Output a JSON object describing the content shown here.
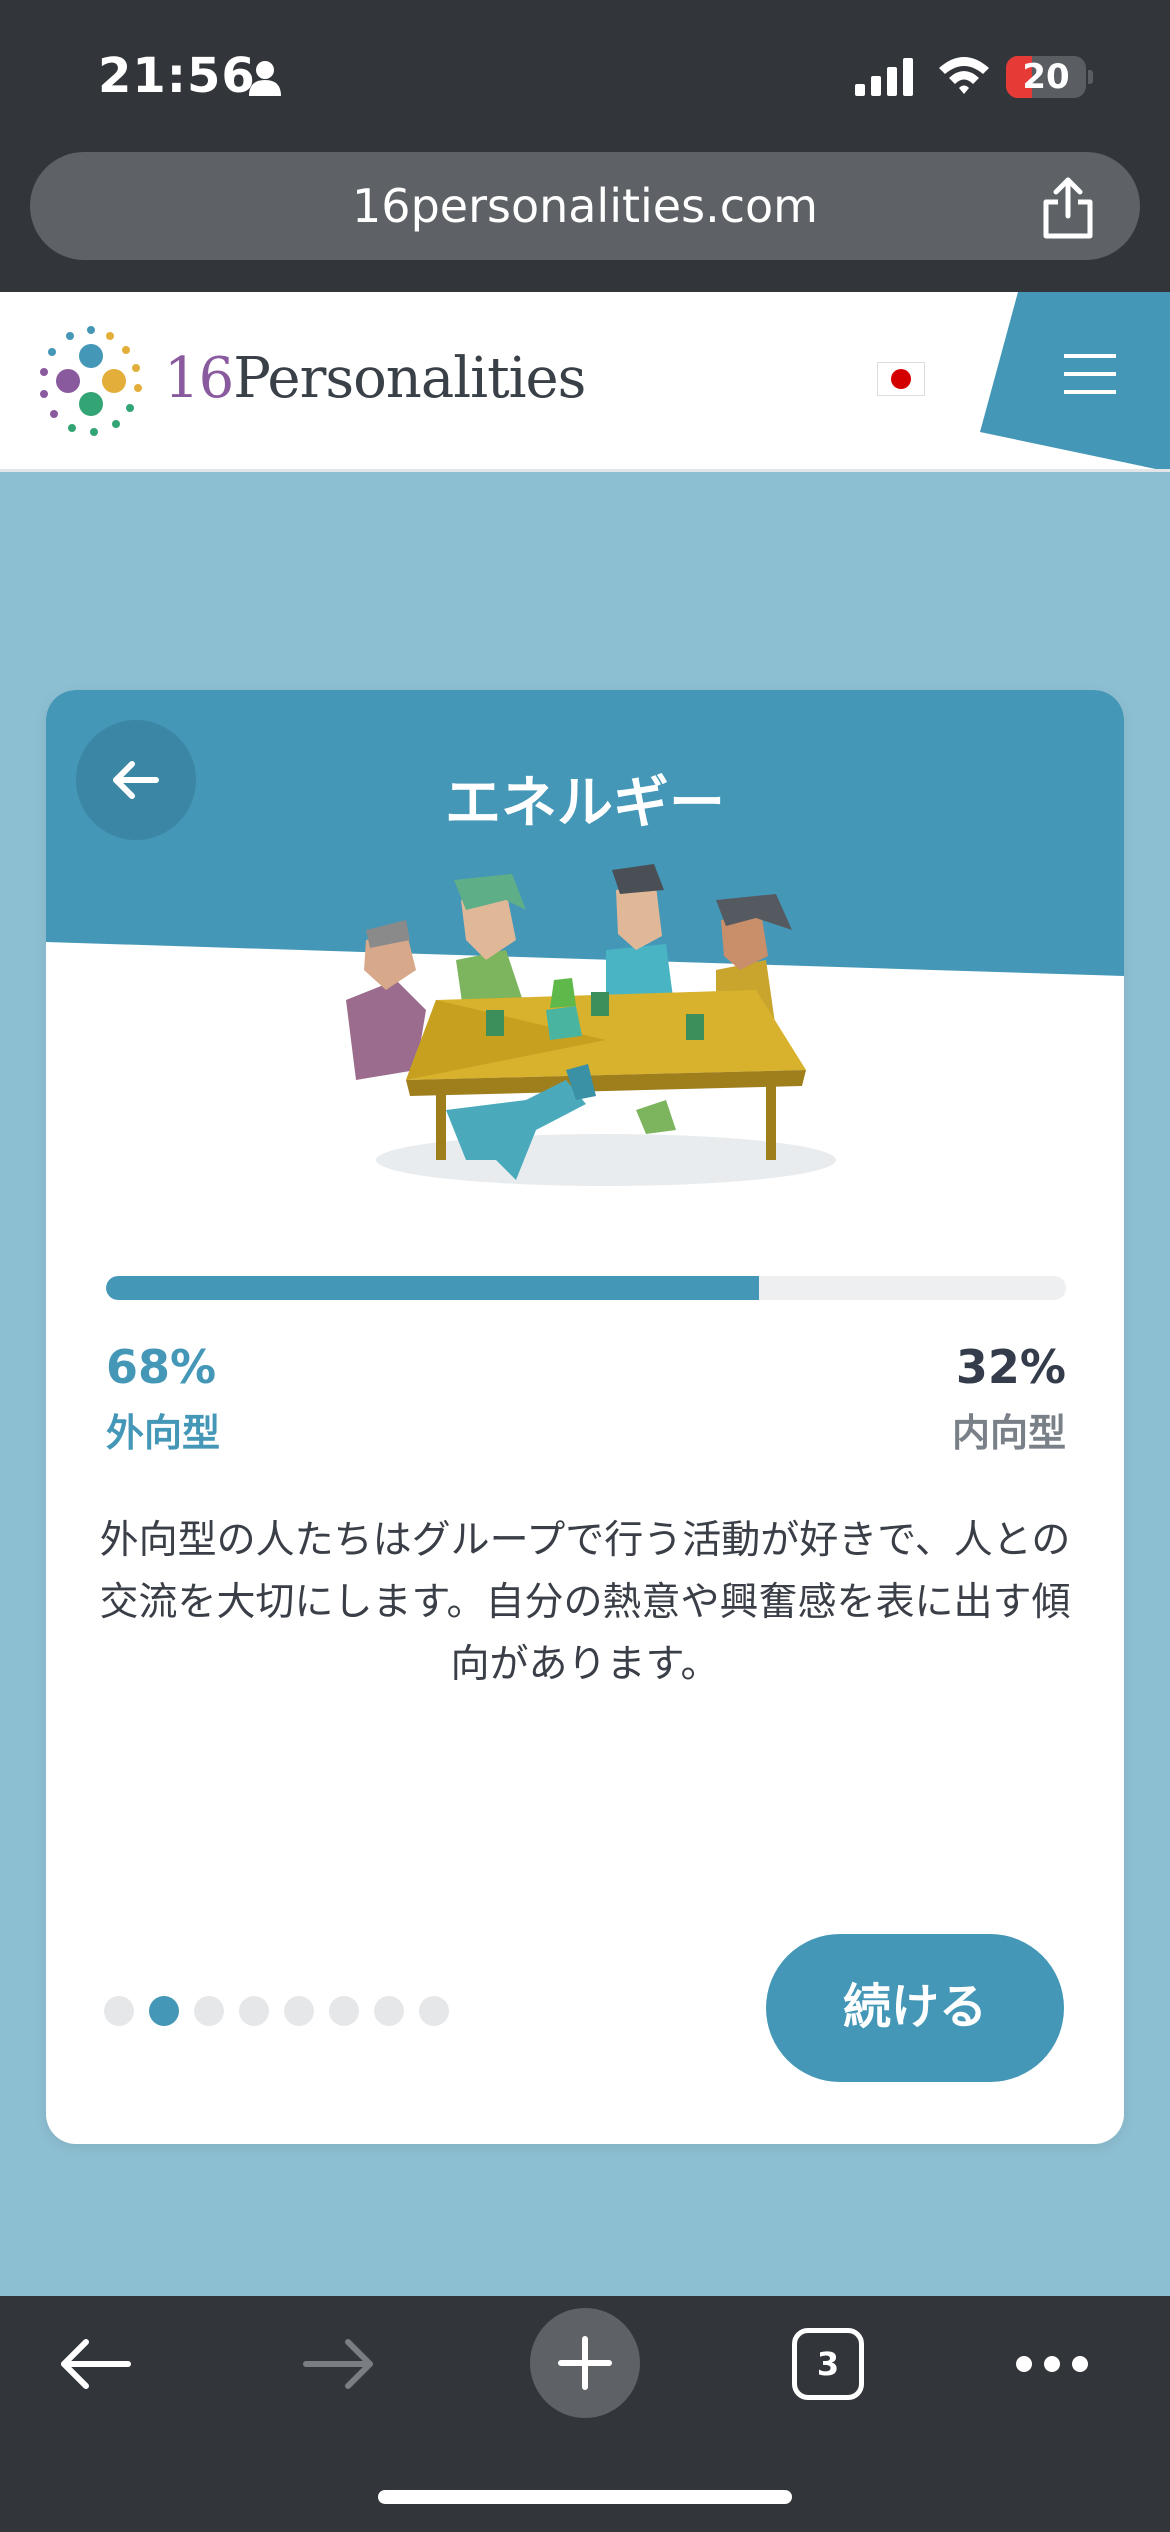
{
  "status_bar": {
    "time": "21:56",
    "battery_level": "20",
    "icons": [
      "person-icon",
      "signal-icon",
      "wifi-icon",
      "battery-icon"
    ]
  },
  "browser": {
    "url": "16personalities.com",
    "tab_count": "3",
    "icons": [
      "share-icon",
      "back-arrow-icon",
      "forward-arrow-icon",
      "plus-icon",
      "tabs-icon",
      "more-icon"
    ]
  },
  "site": {
    "logo_number": "16",
    "logo_word": "Personalities",
    "flag": "japan-flag-icon",
    "menu_icon": "hamburger-menu-icon"
  },
  "card": {
    "title": "エネルギー",
    "illustration": "group-at-table-illustration",
    "progress_fraction": 0.68,
    "left_percent": "68%",
    "left_label": "外向型",
    "right_percent": "32%",
    "right_label": "内向型",
    "description": "外向型の人たちはグループで行う活動が好きで、人との交流を大切にします。自分の熱意や興奮感を表に出す傾向があります。",
    "pagination": {
      "total": 8,
      "active_index": 1
    },
    "continue_label": "続ける"
  },
  "colors": {
    "accent": "#4497b7",
    "page_background": "#8dbfd2",
    "chrome": "#32363a",
    "dark_text": "#343c4b"
  }
}
